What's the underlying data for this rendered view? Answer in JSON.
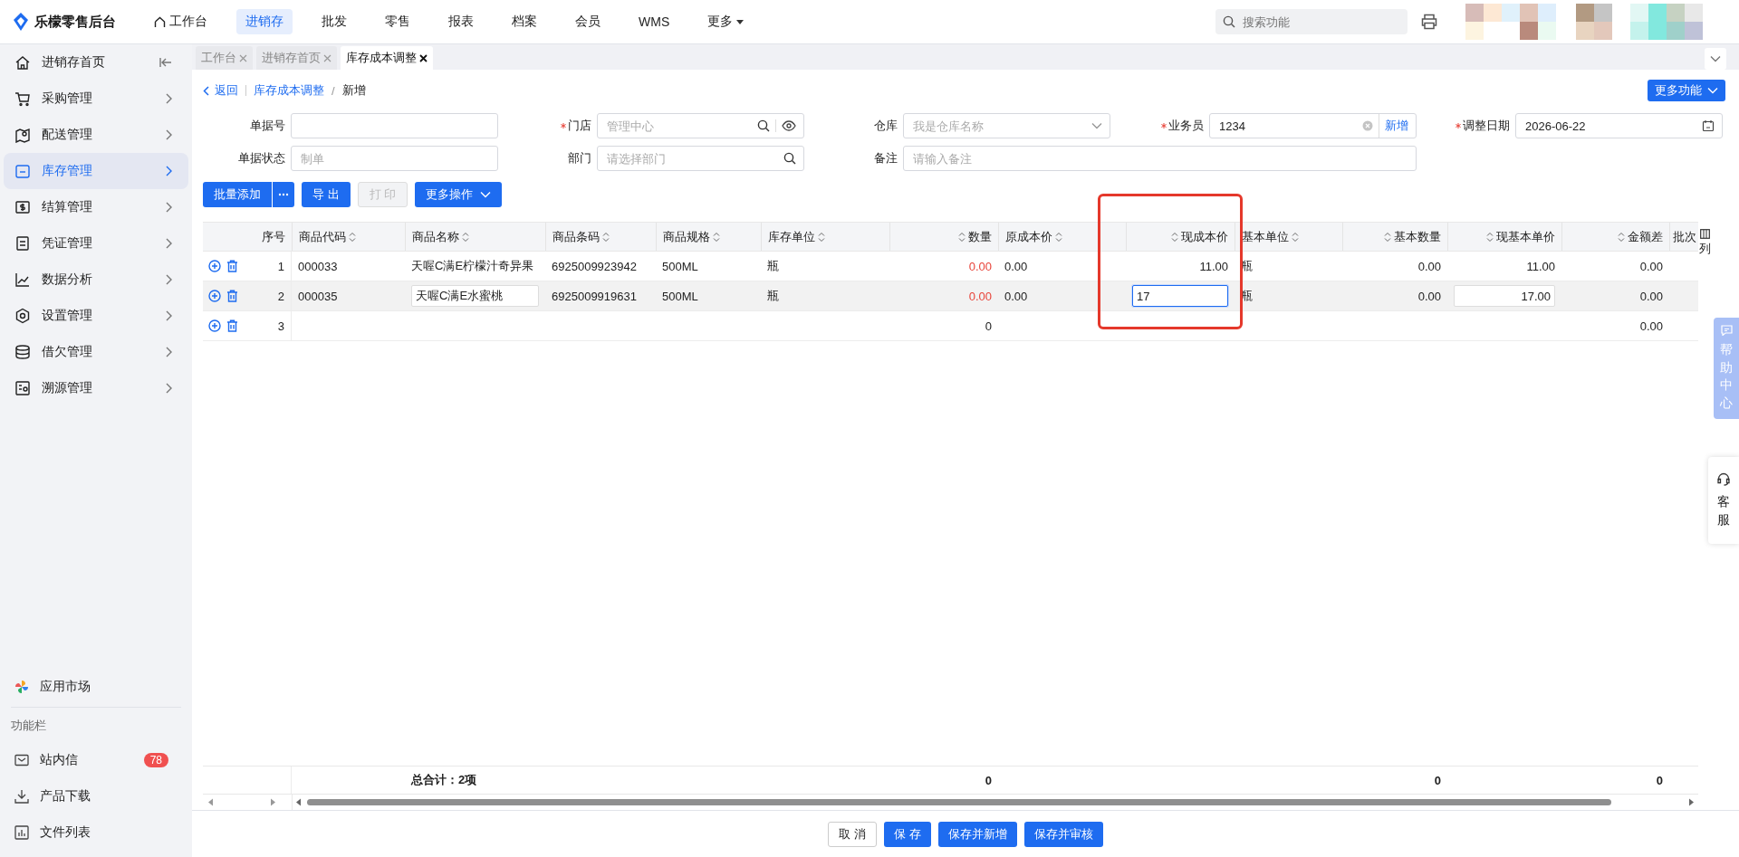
{
  "logo": "乐檬零售后台",
  "nav": [
    {
      "label": "工作台",
      "selected": false,
      "kind": "home"
    },
    {
      "label": "进销存",
      "selected": true,
      "kind": "plain"
    },
    {
      "label": "批发",
      "selected": false,
      "kind": "plain"
    },
    {
      "label": "零售",
      "selected": false,
      "kind": "plain"
    },
    {
      "label": "报表",
      "selected": false,
      "kind": "plain"
    },
    {
      "label": "档案",
      "selected": false,
      "kind": "plain"
    },
    {
      "label": "会员",
      "selected": false,
      "kind": "plain"
    },
    {
      "label": "WMS",
      "selected": false,
      "kind": "plain"
    },
    {
      "label": "更多",
      "selected": false,
      "kind": "dropdown"
    }
  ],
  "search": {
    "placeholder": "搜索功能"
  },
  "sidebar": {
    "items": [
      {
        "label": "进销存首页",
        "selected": false,
        "kind": "collapse"
      },
      {
        "label": "采购管理",
        "selected": false,
        "kind": "expand"
      },
      {
        "label": "配送管理",
        "selected": false,
        "kind": "expand"
      },
      {
        "label": "库存管理",
        "selected": true,
        "kind": "expand"
      },
      {
        "label": "结算管理",
        "selected": false,
        "kind": "expand"
      },
      {
        "label": "凭证管理",
        "selected": false,
        "kind": "expand"
      },
      {
        "label": "数据分析",
        "selected": false,
        "kind": "expand"
      },
      {
        "label": "设置管理",
        "selected": false,
        "kind": "expand"
      },
      {
        "label": "借欠管理",
        "selected": false,
        "kind": "expand"
      },
      {
        "label": "溯源管理",
        "selected": false,
        "kind": "expand"
      }
    ],
    "market": "应用市场",
    "section": "功能栏",
    "tools": [
      {
        "label": "站内信",
        "badge": "78"
      },
      {
        "label": "产品下载"
      },
      {
        "label": "文件列表"
      }
    ]
  },
  "tabs": [
    {
      "label": "工作台",
      "selected": false
    },
    {
      "label": "进销存首页",
      "selected": false
    },
    {
      "label": "库存成本调整",
      "selected": true
    }
  ],
  "breadcrumb": {
    "back": "返回",
    "items": [
      "库存成本调整",
      "新增"
    ],
    "separator": "/"
  },
  "more_functions": "更多功能",
  "form": [
    {
      "label": "单据号",
      "required": false,
      "kind": "text"
    },
    {
      "label": "门店",
      "required": true,
      "kind": "search-eye",
      "placeholder": "管理中心"
    },
    {
      "label": "仓库",
      "required": false,
      "kind": "select",
      "placeholder": "我是仓库名称"
    },
    {
      "label": "业务员",
      "required": true,
      "kind": "clear-add",
      "value": "1234",
      "action": "新增"
    },
    {
      "label": "调整日期",
      "required": true,
      "kind": "date",
      "value": "2026-06-22"
    },
    {
      "label": "单据状态",
      "required": false,
      "kind": "text",
      "placeholder": "制单"
    },
    {
      "label": "部门",
      "required": false,
      "kind": "search",
      "placeholder": "请选择部门"
    },
    {
      "label": "备注",
      "required": false,
      "kind": "wide",
      "placeholder": "请输入备注"
    }
  ],
  "toolbar": [
    {
      "label": "批量添加",
      "kind": "split",
      "disabled": false
    },
    {
      "label": "导 出",
      "kind": "primary",
      "disabled": false
    },
    {
      "label": "打 印",
      "kind": "primary",
      "disabled": true
    },
    {
      "label": "更多操作",
      "kind": "dropdown",
      "disabled": false
    }
  ],
  "table": {
    "columns": [
      {
        "label": "序号",
        "kind": "numeric",
        "sortable": false
      },
      {
        "label": "商品代码",
        "kind": "text",
        "sortable": true
      },
      {
        "label": "商品名称",
        "kind": "text",
        "sortable": true
      },
      {
        "label": "商品条码",
        "kind": "text",
        "sortable": true
      },
      {
        "label": "商品规格",
        "kind": "text",
        "sortable": true
      },
      {
        "label": "库存单位",
        "kind": "text",
        "sortable": true
      },
      {
        "label": "数量",
        "kind": "numeric",
        "sortable": true
      },
      {
        "label": "原成本价",
        "kind": "text",
        "sortable": true
      },
      {
        "label": "现成本价",
        "kind": "numeric",
        "sortable": true
      },
      {
        "label": "基本单位",
        "kind": "text",
        "sortable": true
      },
      {
        "label": "基本数量",
        "kind": "numeric",
        "sortable": true
      },
      {
        "label": "现基本单价",
        "kind": "numeric",
        "sortable": true
      },
      {
        "label": "金额差",
        "kind": "numeric",
        "sortable": true
      },
      {
        "label": "批次",
        "kind": "text",
        "sortable": false
      }
    ],
    "rows": [
      {
        "selected": false,
        "cells": [
          {
            "text": "1",
            "kind": "seq"
          },
          {
            "text": "000033",
            "kind": "text"
          },
          {
            "text": "天喔C满E柠檬汁奇异果",
            "kind": "text"
          },
          {
            "text": "6925009923942",
            "kind": "text"
          },
          {
            "text": "500ML",
            "kind": "text"
          },
          {
            "text": "瓶",
            "kind": "text"
          },
          {
            "text": "0.00",
            "kind": "warn"
          },
          {
            "text": "0.00",
            "kind": "text"
          },
          {
            "text": "11.00",
            "kind": "text"
          },
          {
            "text": "瓶",
            "kind": "text"
          },
          {
            "text": "0.00",
            "kind": "text"
          },
          {
            "text": "11.00",
            "kind": "text"
          },
          {
            "text": "0.00",
            "kind": "text"
          },
          {
            "kind": "blank"
          }
        ]
      },
      {
        "selected": true,
        "cells": [
          {
            "text": "2",
            "kind": "seq"
          },
          {
            "text": "000035",
            "kind": "text"
          },
          {
            "text": "天喔C满E水蜜桃",
            "kind": "input"
          },
          {
            "text": "6925009919631",
            "kind": "text"
          },
          {
            "text": "500ML",
            "kind": "text"
          },
          {
            "text": "瓶",
            "kind": "text"
          },
          {
            "text": "0.00",
            "kind": "warn"
          },
          {
            "text": "0.00",
            "kind": "text"
          },
          {
            "text": "17",
            "kind": "active-input"
          },
          {
            "text": "瓶",
            "kind": "text"
          },
          {
            "text": "0.00",
            "kind": "text"
          },
          {
            "text": "17.00",
            "kind": "input"
          },
          {
            "text": "0.00",
            "kind": "text"
          },
          {
            "kind": "blank"
          }
        ]
      },
      {
        "selected": false,
        "cells": [
          {
            "text": "3",
            "kind": "seq"
          },
          {
            "kind": "blank"
          },
          {
            "kind": "blank"
          },
          {
            "kind": "blank"
          },
          {
            "kind": "blank"
          },
          {
            "kind": "blank"
          },
          {
            "text": "0",
            "kind": "text"
          },
          {
            "kind": "blank"
          },
          {
            "kind": "blank"
          },
          {
            "kind": "blank"
          },
          {
            "kind": "blank"
          },
          {
            "kind": "blank"
          },
          {
            "text": "0.00",
            "kind": "text"
          },
          {
            "kind": "blank"
          }
        ]
      }
    ],
    "footer": [
      {
        "kind": "blank"
      },
      {
        "kind": "blank"
      },
      {
        "text": "总合计：2项",
        "kind": "text"
      },
      {
        "kind": "blank"
      },
      {
        "kind": "blank"
      },
      {
        "kind": "blank"
      },
      {
        "text": "0",
        "kind": "text"
      },
      {
        "kind": "blank"
      },
      {
        "kind": "blank"
      },
      {
        "kind": "blank"
      },
      {
        "text": "0",
        "kind": "text"
      },
      {
        "kind": "blank"
      },
      {
        "text": "0",
        "kind": "text"
      },
      {
        "kind": "blank"
      }
    ],
    "column_settings": "列"
  },
  "actions": [
    {
      "label": "取 消",
      "kind": "plain"
    },
    {
      "label": "保 存",
      "kind": "primary"
    },
    {
      "label": "保存并新增",
      "kind": "primary"
    },
    {
      "label": "保存并审核",
      "kind": "primary"
    }
  ],
  "help": {
    "label": "帮助中心",
    "service": "客服"
  }
}
